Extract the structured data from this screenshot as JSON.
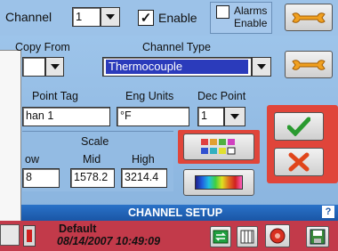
{
  "header": {
    "channel_label": "Channel",
    "channel_value": "1",
    "enable_label": "Enable",
    "enable_checked": "✓",
    "alarms_label_line1": "Alarms",
    "alarms_label_line2": "Enable"
  },
  "form": {
    "copy_from_label": "Copy From",
    "channel_type_label": "Channel Type",
    "channel_type_value": "Thermocouple",
    "point_tag_label": "Point Tag",
    "point_tag_value": "han 1",
    "eng_units_label": "Eng Units",
    "eng_units_value": "°F",
    "dec_point_label": "Dec Point",
    "dec_point_value": "1",
    "scale_label": "Scale",
    "low_label": "ow",
    "low_value": "8",
    "mid_label": "Mid",
    "mid_value": "1578.2",
    "high_label": "High",
    "high_value": "3214.4"
  },
  "footer": {
    "title": "CHANNEL SETUP",
    "help_label": "?",
    "status_name": "Default",
    "status_datetime": "08/14/2007 10:49:09"
  },
  "colors": {
    "accent_red": "#e0453a",
    "selection_blue": "#2b3bbb",
    "status_red": "#c23a4a"
  }
}
